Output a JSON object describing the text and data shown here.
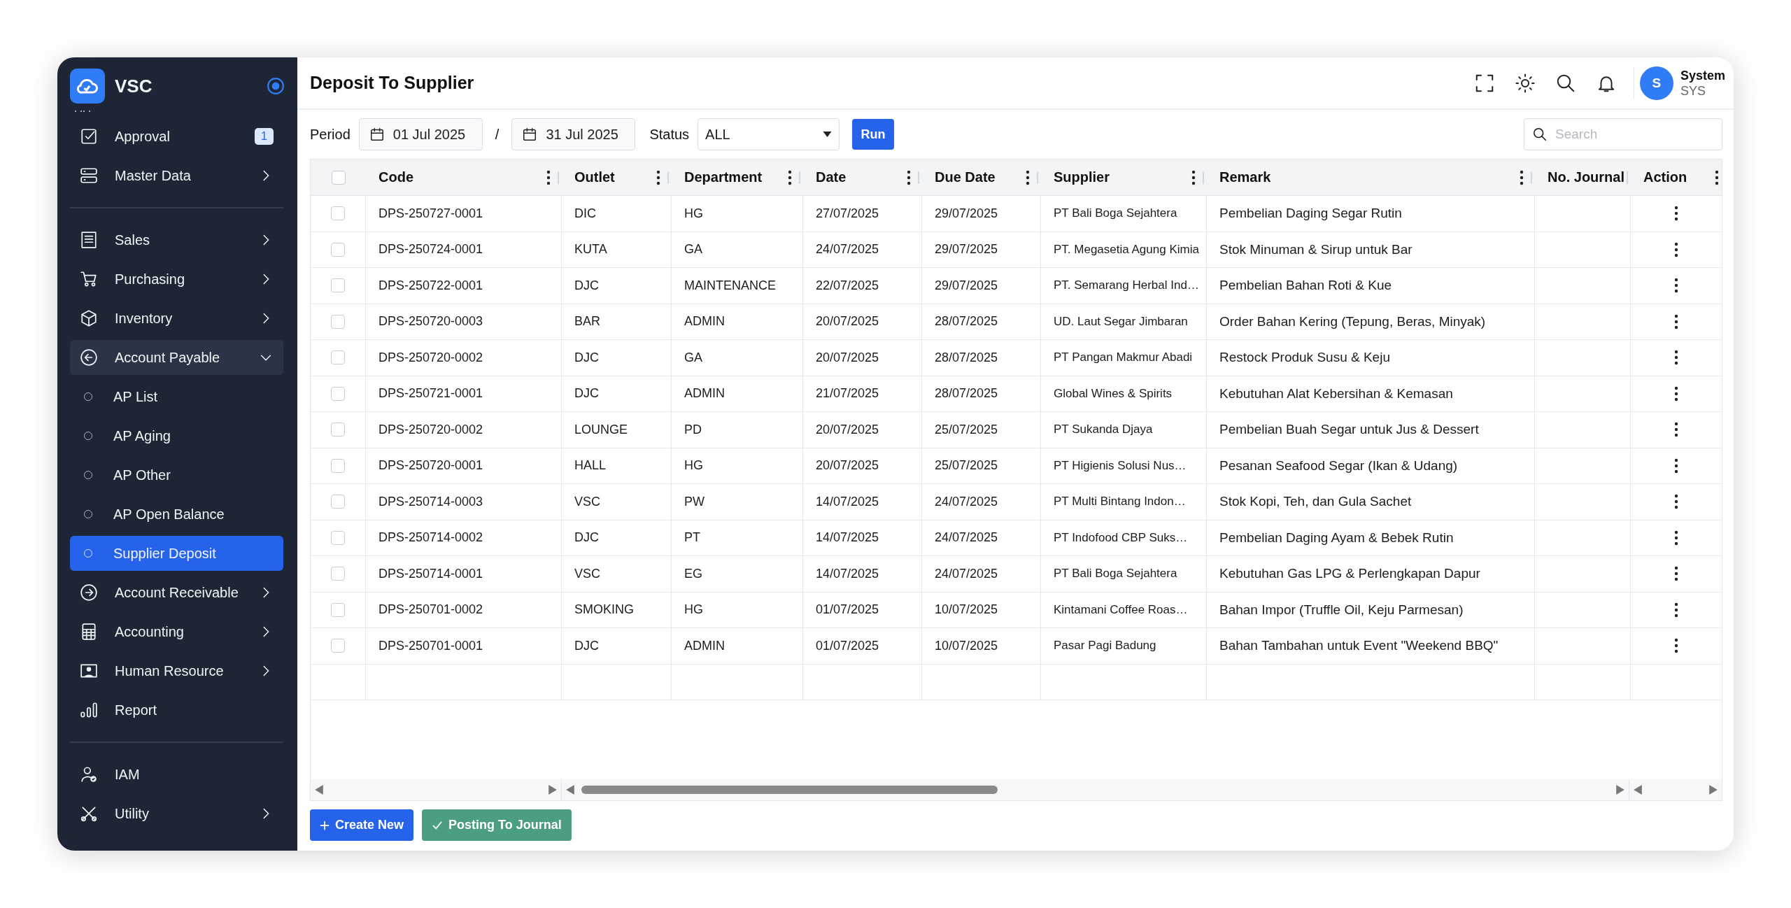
{
  "sidebar": {
    "brand": "VSC",
    "sections": [
      {
        "items": [
          {
            "kind": "link",
            "label": "Approval",
            "selected": false,
            "badge": "1"
          },
          {
            "kind": "menu",
            "label": "Master Data",
            "selected": false,
            "expanded": false
          }
        ]
      },
      {
        "items": [
          {
            "kind": "menu",
            "label": "Sales",
            "selected": false,
            "expanded": false
          },
          {
            "kind": "menu",
            "label": "Purchasing",
            "selected": false,
            "expanded": false
          },
          {
            "kind": "menu",
            "label": "Inventory",
            "selected": false,
            "expanded": false
          },
          {
            "kind": "menu",
            "label": "Account Payable",
            "selected": false,
            "expanded": true,
            "children": [
              {
                "kind": "sub",
                "label": "AP List",
                "selected": false
              },
              {
                "kind": "sub",
                "label": "AP Aging",
                "selected": false
              },
              {
                "kind": "sub",
                "label": "AP Other",
                "selected": false
              },
              {
                "kind": "sub",
                "label": "AP Open Balance",
                "selected": false
              },
              {
                "kind": "sub",
                "label": "Supplier Deposit",
                "selected": true
              }
            ]
          },
          {
            "kind": "menu",
            "label": "Account Receivable",
            "selected": false,
            "expanded": false
          },
          {
            "kind": "menu",
            "label": "Accounting",
            "selected": false,
            "expanded": false
          },
          {
            "kind": "menu",
            "label": "Human Resource",
            "selected": false,
            "expanded": false
          },
          {
            "kind": "link",
            "label": "Report",
            "selected": false
          }
        ]
      },
      {
        "items": [
          {
            "kind": "link",
            "label": "IAM",
            "selected": false
          },
          {
            "kind": "menu",
            "label": "Utility",
            "selected": false,
            "expanded": false
          }
        ]
      }
    ]
  },
  "header": {
    "title": "Deposit To Supplier",
    "user": {
      "initial": "S",
      "name": "System",
      "role": "SYS"
    }
  },
  "filters": {
    "period_label": "Period",
    "date_from": "01 Jul 2025",
    "separator": "/",
    "date_to": "31 Jul 2025",
    "status_label": "Status",
    "status": "ALL",
    "run_button": "Run",
    "search": {
      "placeholder": "Search"
    }
  },
  "table": {
    "select_all_checked": false,
    "columns": [
      {
        "label": "Code",
        "menu": true
      },
      {
        "label": "Outlet",
        "menu": true
      },
      {
        "label": "Department",
        "menu": true
      },
      {
        "label": "Date",
        "menu": true
      },
      {
        "label": "Due Date",
        "menu": true
      },
      {
        "label": "Supplier",
        "menu": true
      },
      {
        "label": "Remark",
        "menu": true
      },
      {
        "label": "No. Journal",
        "menu": false
      },
      {
        "label": "Action",
        "menu": true
      }
    ],
    "rows": [
      {
        "checked": false,
        "cells": [
          "DPS-250727-0001",
          "DIC",
          "HG",
          "27/07/2025",
          "29/07/2025",
          "PT Bali Boga Sejahtera",
          "Pembelian Daging Segar Rutin",
          ""
        ]
      },
      {
        "checked": false,
        "cells": [
          "DPS-250724-0001",
          "KUTA",
          "GA",
          "24/07/2025",
          "29/07/2025",
          "PT. Megasetia Agung Kimia",
          "Stok Minuman & Sirup untuk Bar",
          ""
        ]
      },
      {
        "checked": false,
        "cells": [
          "DPS-250722-0001",
          "DJC",
          "MAINTENANCE",
          "22/07/2025",
          "29/07/2025",
          "PT. Semarang Herbal Ind…",
          "Pembelian Bahan Roti & Kue",
          ""
        ]
      },
      {
        "checked": false,
        "cells": [
          "DPS-250720-0003",
          "BAR",
          "ADMIN",
          "20/07/2025",
          "28/07/2025",
          "UD. Laut Segar Jimbaran",
          "Order Bahan Kering (Tepung, Beras, Minyak)",
          ""
        ]
      },
      {
        "checked": false,
        "cells": [
          "DPS-250720-0002",
          "DJC",
          "GA",
          "20/07/2025",
          "28/07/2025",
          "PT Pangan Makmur Abadi",
          "Restock Produk Susu & Keju",
          ""
        ]
      },
      {
        "checked": false,
        "cells": [
          "DPS-250721-0001",
          "DJC",
          "ADMIN",
          "21/07/2025",
          "28/07/2025",
          "Global Wines & Spirits",
          "Kebutuhan Alat Kebersihan & Kemasan",
          ""
        ]
      },
      {
        "checked": false,
        "cells": [
          "DPS-250720-0002",
          "LOUNGE",
          "PD",
          "20/07/2025",
          "25/07/2025",
          "PT Sukanda Djaya",
          "Pembelian Buah Segar untuk Jus & Dessert",
          ""
        ]
      },
      {
        "checked": false,
        "cells": [
          "DPS-250720-0001",
          "HALL",
          "HG",
          "20/07/2025",
          "25/07/2025",
          "PT Higienis Solusi Nus…",
          "Pesanan Seafood Segar (Ikan & Udang)",
          ""
        ]
      },
      {
        "checked": false,
        "cells": [
          "DPS-250714-0003",
          "VSC",
          "PW",
          "14/07/2025",
          "24/07/2025",
          "PT Multi Bintang Indon…",
          "Stok Kopi, Teh, dan Gula Sachet",
          ""
        ]
      },
      {
        "checked": false,
        "cells": [
          "DPS-250714-0002",
          "DJC",
          "PT",
          "14/07/2025",
          "24/07/2025",
          "PT Indofood CBP Suks…",
          "Pembelian Daging Ayam & Bebek Rutin",
          ""
        ]
      },
      {
        "checked": false,
        "cells": [
          "DPS-250714-0001",
          "VSC",
          "EG",
          "14/07/2025",
          "24/07/2025",
          "PT Bali Boga Sejahtera",
          "Kebutuhan Gas LPG & Perlengkapan Dapur",
          ""
        ]
      },
      {
        "checked": false,
        "cells": [
          "DPS-250701-0002",
          "SMOKING",
          "HG",
          "01/07/2025",
          "10/07/2025",
          "Kintamani Coffee Roas…",
          "Bahan Impor (Truffle Oil, Keju Parmesan)",
          ""
        ]
      },
      {
        "checked": false,
        "cells": [
          "DPS-250701-0001",
          "DJC",
          "ADMIN",
          "01/07/2025",
          "10/07/2025",
          "Pasar Pagi Badung",
          "Bahan Tambahan untuk Event \"Weekend BBQ\"",
          ""
        ]
      }
    ]
  },
  "actions": [
    {
      "kind": "primary",
      "label": "Create New"
    },
    {
      "kind": "success",
      "label": "Posting To Journal"
    }
  ]
}
